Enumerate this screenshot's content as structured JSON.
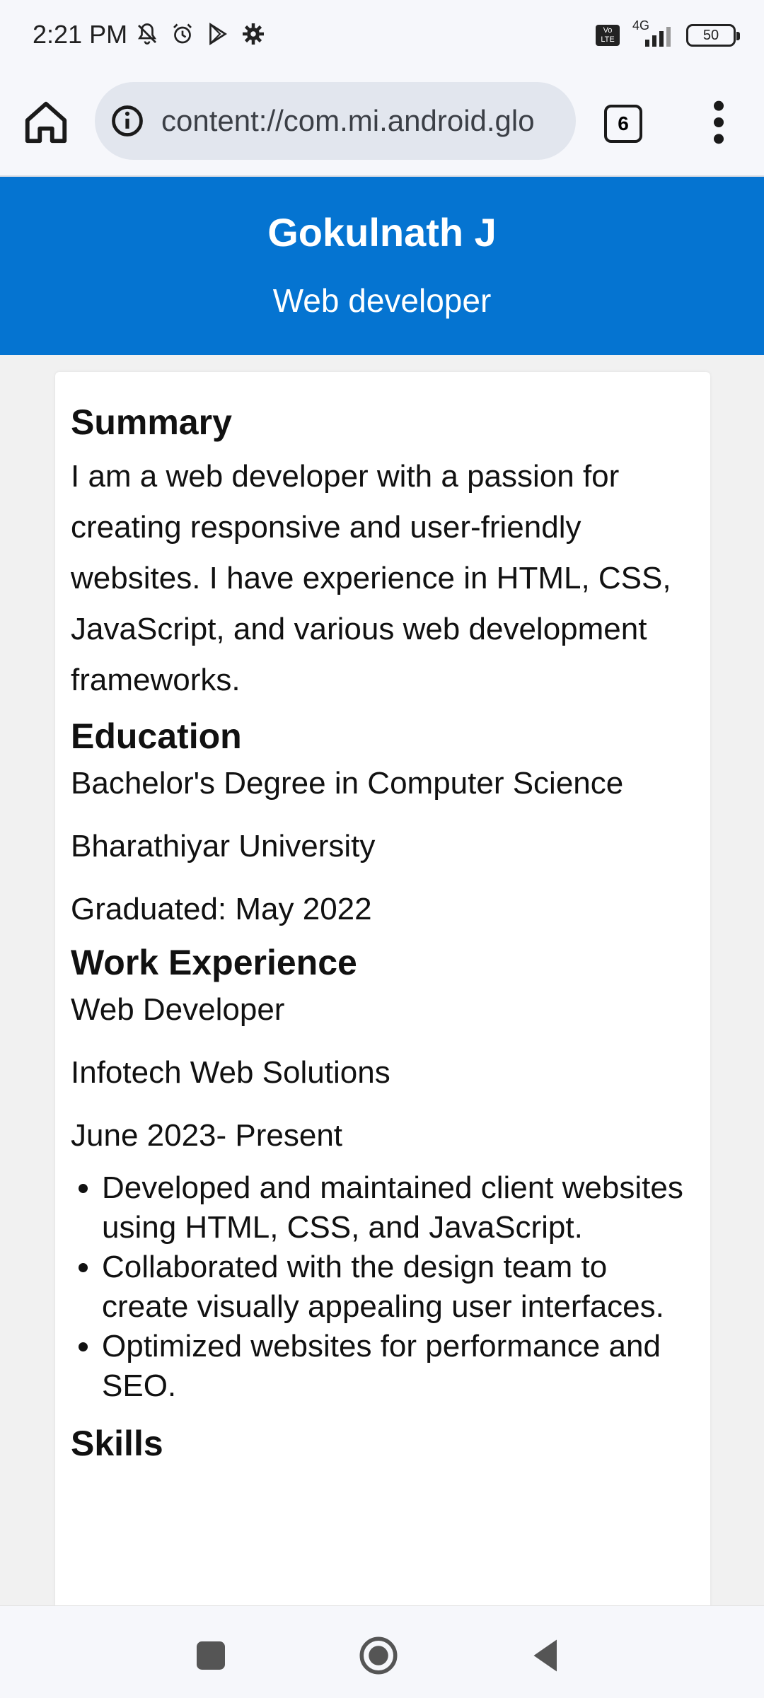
{
  "status_bar": {
    "time": "2:21 PM",
    "left_icons": [
      "mute-bell-icon",
      "alarm-icon",
      "play-store-icon",
      "settings-gear-icon"
    ],
    "network_label": "4G",
    "volte_label": "Vo LTE",
    "battery": "50"
  },
  "toolbar": {
    "url": "content://com.mi.android.glo",
    "tab_count": "6"
  },
  "header": {
    "name": "Gokulnath J",
    "role": "Web developer",
    "color": "#0574d1"
  },
  "resume": {
    "summary_title": "Summary",
    "summary_text": "I am a web developer with a passion for creating responsive and user-friendly websites. I have experience in HTML, CSS, JavaScript, and various web development frameworks.",
    "education_title": "Education",
    "education_lines": [
      "Bachelor's Degree in Computer Science",
      "Bharathiyar University",
      "Graduated: May 2022"
    ],
    "work_title": "Work Experience",
    "work_lines": [
      "Web Developer",
      "Infotech Web Solutions",
      "June 2023- Present"
    ],
    "work_bullets": [
      "Developed and maintained client websites using HTML, CSS, and JavaScript.",
      "Collaborated with the design team to create visually appealing user interfaces.",
      "Optimized websites for performance and SEO."
    ],
    "skills_title": "Skills"
  },
  "nav_bar": {
    "buttons": [
      "recents-square-icon",
      "home-circle-icon",
      "back-triangle-icon"
    ]
  }
}
